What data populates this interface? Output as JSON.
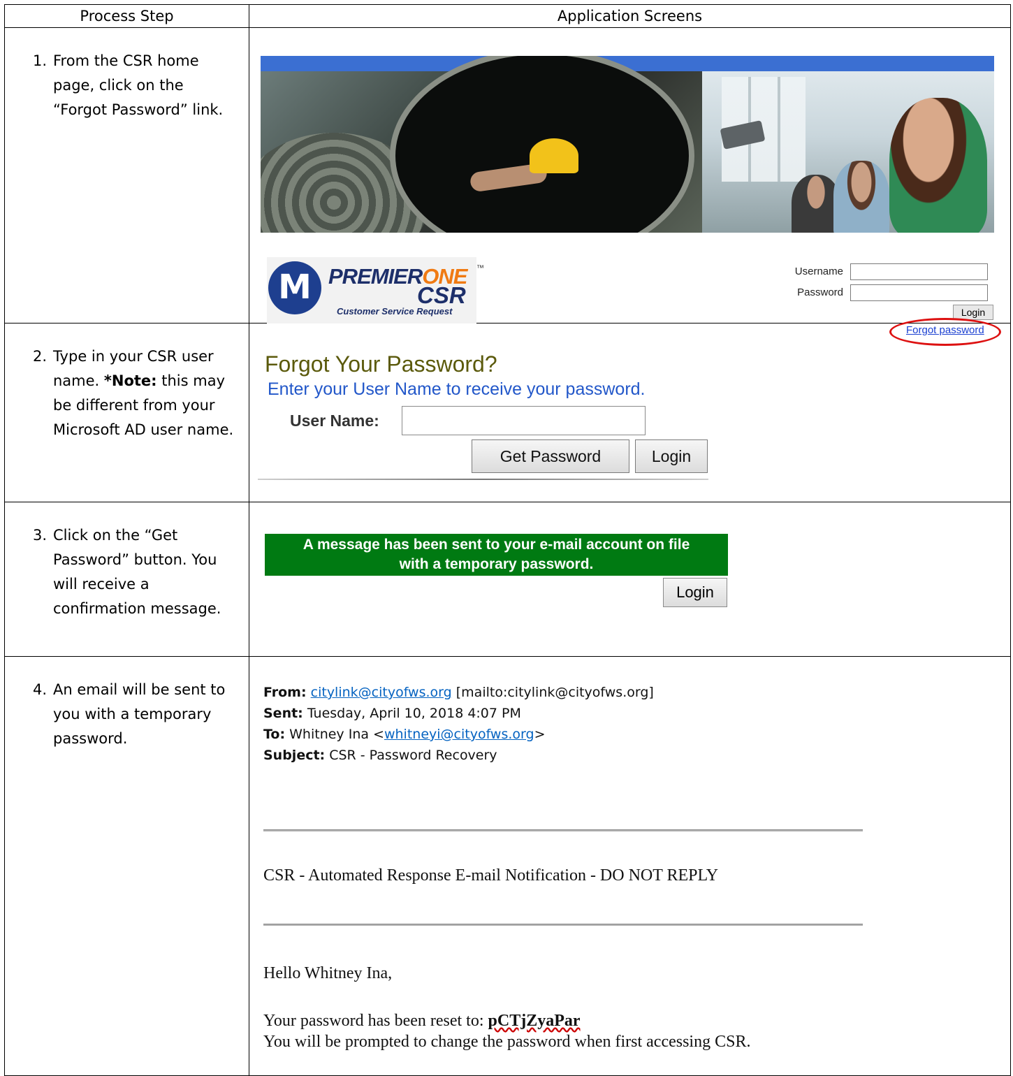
{
  "header": {
    "col1": "Process Step",
    "col2": "Application Screens"
  },
  "steps": [
    {
      "num": "1.",
      "text": "From the CSR home page, click on the “Forgot Password” link."
    },
    {
      "num": "2.",
      "text_before": "Type in your CSR user name. ",
      "note_label": "*Note:",
      "text_after": " this may be different from your Microsoft AD user name."
    },
    {
      "num": "3.",
      "text": "Click on the “Get Password” button. You will receive a confirmation message."
    },
    {
      "num": "4.",
      "text": "An email will be sent to you with a temporary password."
    }
  ],
  "login_screen": {
    "logo_premier": "PREMIER",
    "logo_one": "ONE",
    "logo_tm": "™",
    "logo_csr": "CSR",
    "logo_sub": "Customer Service Request",
    "username_label": "Username",
    "password_label": "Password",
    "login_button": "Login",
    "forgot_link": "Forgot password"
  },
  "forgot_screen": {
    "title": "Forgot Your Password?",
    "subtitle": "Enter your User Name to receive your password.",
    "user_label": "User Name:",
    "get_password_button": "Get Password",
    "login_button": "Login"
  },
  "confirm_screen": {
    "message_line1": "A message has been sent to your e-mail account on file",
    "message_line2": "with a temporary password.",
    "login_button": "Login"
  },
  "email": {
    "from_label": "From:",
    "from_address": "citylink@cityofws.org",
    "from_mailto": "[mailto:citylink@cityofws.org]",
    "sent_label": "Sent:",
    "sent_value": "Tuesday, April 10, 2018 4:07 PM",
    "to_label": "To:",
    "to_name": "Whitney Ina <",
    "to_address": "whitneyi@cityofws.org",
    "to_close": ">",
    "subject_label": "Subject:",
    "subject_value": "CSR - Password Recovery",
    "banner": "CSR - Automated Response E-mail Notification - DO NOT REPLY",
    "greeting": "Hello Whitney Ina,",
    "reset_text": "Your password has been reset to: ",
    "temp_password": "pCTjZyaPar",
    "prompt_text": "You will be prompted to change the password when first accessing CSR."
  }
}
